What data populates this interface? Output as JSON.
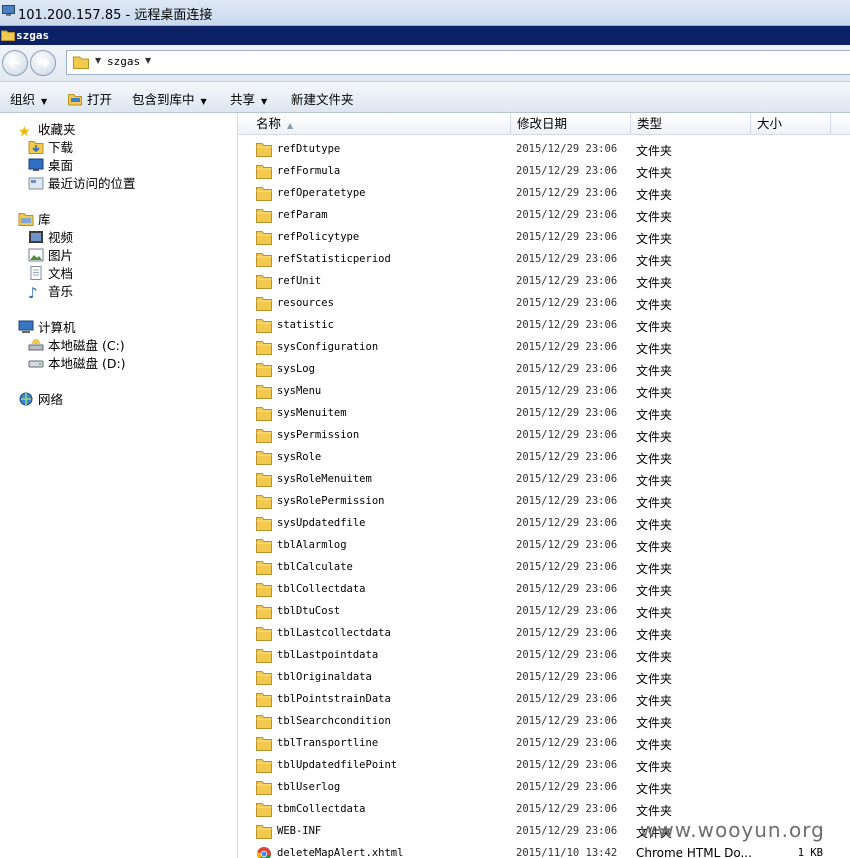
{
  "rdp": {
    "title": "101.200.157.85 - 远程桌面连接",
    "icon": "remote-desktop-icon"
  },
  "window": {
    "title": "szgas",
    "icon": "folder-icon"
  },
  "address": {
    "crumb": "szgas"
  },
  "toolbar": {
    "organize": "组织",
    "open": "打开",
    "include_library": "包含到库中",
    "share": "共享",
    "new_folder": "新建文件夹"
  },
  "nav": {
    "favorites": "收藏夹",
    "downloads": "下载",
    "desktop": "桌面",
    "recent": "最近访问的位置",
    "libraries": "库",
    "videos": "视频",
    "pictures": "图片",
    "documents": "文档",
    "music": "音乐",
    "computer": "计算机",
    "disk_c": "本地磁盘 (C:)",
    "disk_d": "本地磁盘 (D:)",
    "network": "网络"
  },
  "columns": {
    "name": "名称",
    "modified": "修改日期",
    "type": "类型",
    "size": "大小"
  },
  "files": [
    {
      "name": "refDtutype",
      "date": "2015/12/29 23:06",
      "type": "文件夹",
      "size": ""
    },
    {
      "name": "refFormula",
      "date": "2015/12/29 23:06",
      "type": "文件夹",
      "size": ""
    },
    {
      "name": "refOperatetype",
      "date": "2015/12/29 23:06",
      "type": "文件夹",
      "size": ""
    },
    {
      "name": "refParam",
      "date": "2015/12/29 23:06",
      "type": "文件夹",
      "size": ""
    },
    {
      "name": "refPolicytype",
      "date": "2015/12/29 23:06",
      "type": "文件夹",
      "size": ""
    },
    {
      "name": "refStatisticperiod",
      "date": "2015/12/29 23:06",
      "type": "文件夹",
      "size": ""
    },
    {
      "name": "refUnit",
      "date": "2015/12/29 23:06",
      "type": "文件夹",
      "size": ""
    },
    {
      "name": "resources",
      "date": "2015/12/29 23:06",
      "type": "文件夹",
      "size": ""
    },
    {
      "name": "statistic",
      "date": "2015/12/29 23:06",
      "type": "文件夹",
      "size": ""
    },
    {
      "name": "sysConfiguration",
      "date": "2015/12/29 23:06",
      "type": "文件夹",
      "size": ""
    },
    {
      "name": "sysLog",
      "date": "2015/12/29 23:06",
      "type": "文件夹",
      "size": ""
    },
    {
      "name": "sysMenu",
      "date": "2015/12/29 23:06",
      "type": "文件夹",
      "size": ""
    },
    {
      "name": "sysMenuitem",
      "date": "2015/12/29 23:06",
      "type": "文件夹",
      "size": ""
    },
    {
      "name": "sysPermission",
      "date": "2015/12/29 23:06",
      "type": "文件夹",
      "size": ""
    },
    {
      "name": "sysRole",
      "date": "2015/12/29 23:06",
      "type": "文件夹",
      "size": ""
    },
    {
      "name": "sysRoleMenuitem",
      "date": "2015/12/29 23:06",
      "type": "文件夹",
      "size": ""
    },
    {
      "name": "sysRolePermission",
      "date": "2015/12/29 23:06",
      "type": "文件夹",
      "size": ""
    },
    {
      "name": "sysUpdatedfile",
      "date": "2015/12/29 23:06",
      "type": "文件夹",
      "size": ""
    },
    {
      "name": "tblAlarmlog",
      "date": "2015/12/29 23:06",
      "type": "文件夹",
      "size": ""
    },
    {
      "name": "tblCalculate",
      "date": "2015/12/29 23:06",
      "type": "文件夹",
      "size": ""
    },
    {
      "name": "tblCollectdata",
      "date": "2015/12/29 23:06",
      "type": "文件夹",
      "size": ""
    },
    {
      "name": "tblDtuCost",
      "date": "2015/12/29 23:06",
      "type": "文件夹",
      "size": ""
    },
    {
      "name": "tblLastcollectdata",
      "date": "2015/12/29 23:06",
      "type": "文件夹",
      "size": ""
    },
    {
      "name": "tblLastpointdata",
      "date": "2015/12/29 23:06",
      "type": "文件夹",
      "size": ""
    },
    {
      "name": "tblOriginaldata",
      "date": "2015/12/29 23:06",
      "type": "文件夹",
      "size": ""
    },
    {
      "name": "tblPointstrainData",
      "date": "2015/12/29 23:06",
      "type": "文件夹",
      "size": ""
    },
    {
      "name": "tblSearchcondition",
      "date": "2015/12/29 23:06",
      "type": "文件夹",
      "size": ""
    },
    {
      "name": "tblTransportline",
      "date": "2015/12/29 23:06",
      "type": "文件夹",
      "size": ""
    },
    {
      "name": "tblUpdatedfilePoint",
      "date": "2015/12/29 23:06",
      "type": "文件夹",
      "size": ""
    },
    {
      "name": "tblUserlog",
      "date": "2015/12/29 23:06",
      "type": "文件夹",
      "size": ""
    },
    {
      "name": "tbmCollectdata",
      "date": "2015/12/29 23:06",
      "type": "文件夹",
      "size": ""
    },
    {
      "name": "WEB-INF",
      "date": "2015/12/29 23:06",
      "type": "文件夹",
      "size": ""
    },
    {
      "name": "deleteMapAlert.xhtml",
      "date": "2015/11/10 13:42",
      "type": "Chrome HTML Do...",
      "size": "1 KB",
      "icon": "chrome-icon"
    }
  ],
  "watermark": "www.wooyun.org",
  "colors": {
    "title_bar": "#0c2166",
    "folder": "#f2c94c"
  }
}
